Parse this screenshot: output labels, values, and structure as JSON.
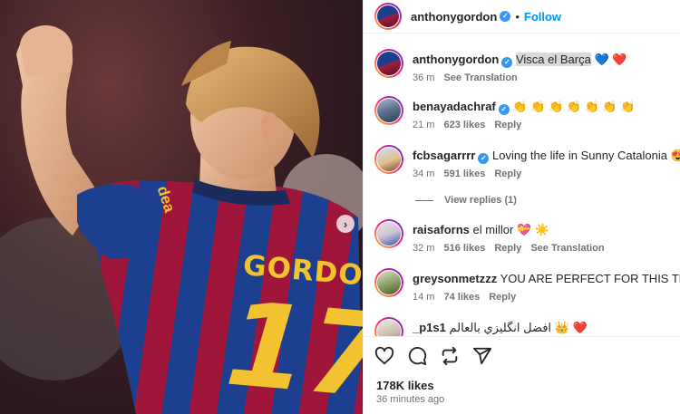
{
  "post": {
    "author": "anthonygordon",
    "follow_label": "Follow",
    "dot": "•",
    "next_icon": "chevron-right-icon",
    "likes": "178K likes",
    "time": "36 minutes ago"
  },
  "jersey": {
    "name": "GORDON",
    "number": "17",
    "sleeve_text": "dea"
  },
  "caption": {
    "username": "anthonygordon",
    "text": "Visca el Barça",
    "emoji": "💙 ❤️",
    "time": "36 m",
    "translate": "See Translation"
  },
  "comments": [
    {
      "username": "benayadachraf",
      "verified": true,
      "text": "👏 👏 👏 👏 👏 👏 👏",
      "time": "21 m",
      "likes": "623 likes",
      "reply": "Reply",
      "extra": ""
    },
    {
      "username": "fcbsagarrrr",
      "verified": true,
      "text": "Loving the life in Sunny Catalonia 😍",
      "time": "34 m",
      "likes": "591 likes",
      "reply": "Reply",
      "extra": ""
    },
    {
      "username": "raisaforns",
      "verified": false,
      "text": "el millor 💝 ☀️",
      "time": "32 m",
      "likes": "516 likes",
      "reply": "Reply",
      "extra": "See Translation"
    },
    {
      "username": "greysonmetzzz",
      "verified": false,
      "text": "YOU ARE PERFECT FOR THIS TEAM 💙 ❤️",
      "time": "14 m",
      "likes": "74 likes",
      "reply": "Reply",
      "extra": ""
    },
    {
      "username": "_p1s1",
      "verified": false,
      "text": "❤️ 👑 افضل انگليزي بالعالم",
      "time": "",
      "likes": "",
      "reply": "",
      "extra": ""
    }
  ],
  "view_replies": "View replies (1)",
  "actions": [
    "heart-icon",
    "comment-icon",
    "repost-icon",
    "share-icon"
  ],
  "colors": {
    "accent": "#0095f6",
    "verified": "#3897f0",
    "barca_blue": "#1d3f8f",
    "barca_red": "#a0163a",
    "gold": "#f2c230"
  }
}
